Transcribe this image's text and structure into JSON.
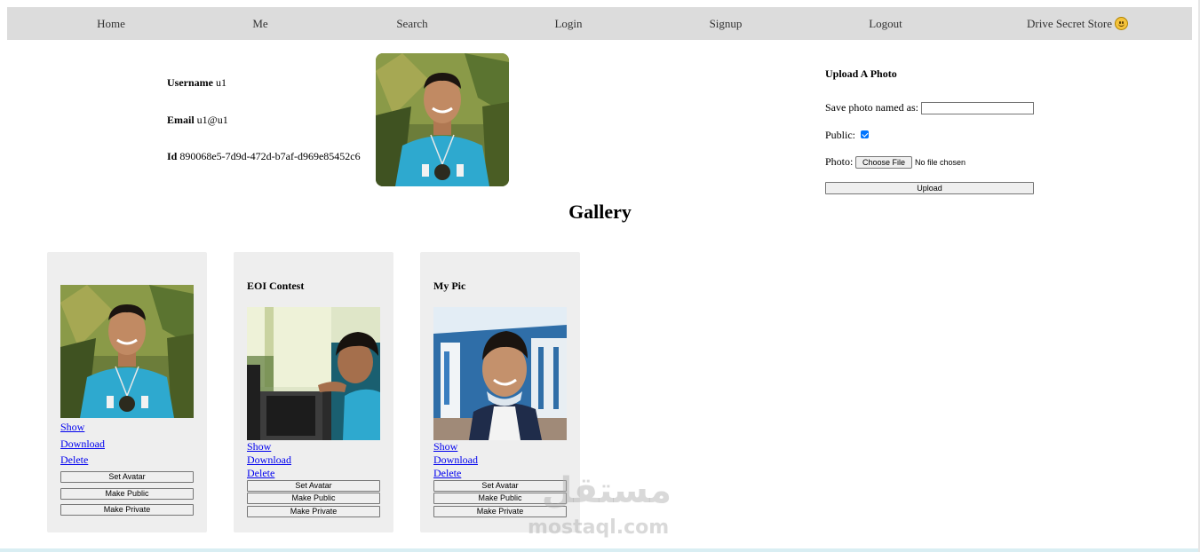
{
  "nav": {
    "items": [
      "Home",
      "Me",
      "Search",
      "Login",
      "Signup",
      "Logout",
      "Drive Secret Store"
    ],
    "last_icon": "smiley-face-icon"
  },
  "profile": {
    "username_label": "Username",
    "username": "u1",
    "email_label": "Email",
    "email": "u1@u1",
    "id_label": "Id",
    "id": "890068e5-7d9d-472d-b7af-d969e85452c6"
  },
  "upload": {
    "title": "Upload A Photo",
    "name_label": "Save photo named as:",
    "name_value": "",
    "public_label": "Public:",
    "public_checked": true,
    "photo_label": "Photo:",
    "choose_file": "Choose File",
    "no_file": "No file chosen",
    "upload_button": "Upload"
  },
  "gallery": {
    "title": "Gallery",
    "cards": [
      {
        "title": "",
        "photo": "portrait-blue-shirt-garden-photo",
        "show": "Show",
        "download": "Download",
        "delete": "Delete",
        "set_avatar": "Set Avatar",
        "make_public": "Make Public",
        "make_private": "Make Private"
      },
      {
        "title": "EOI Contest",
        "photo": "contest-computer-photo",
        "show": "Show",
        "download": "Download",
        "delete": "Delete",
        "set_avatar": "Set Avatar",
        "make_public": "Make Public",
        "make_private": "Make Private"
      },
      {
        "title": "My Pic",
        "photo": "selfie-building-photo",
        "show": "Show",
        "download": "Download",
        "delete": "Delete",
        "set_avatar": "Set Avatar",
        "make_public": "Make Public",
        "make_private": "Make Private"
      }
    ]
  },
  "watermark": {
    "arabic": "مستقل",
    "latin": "mostaql.com"
  }
}
